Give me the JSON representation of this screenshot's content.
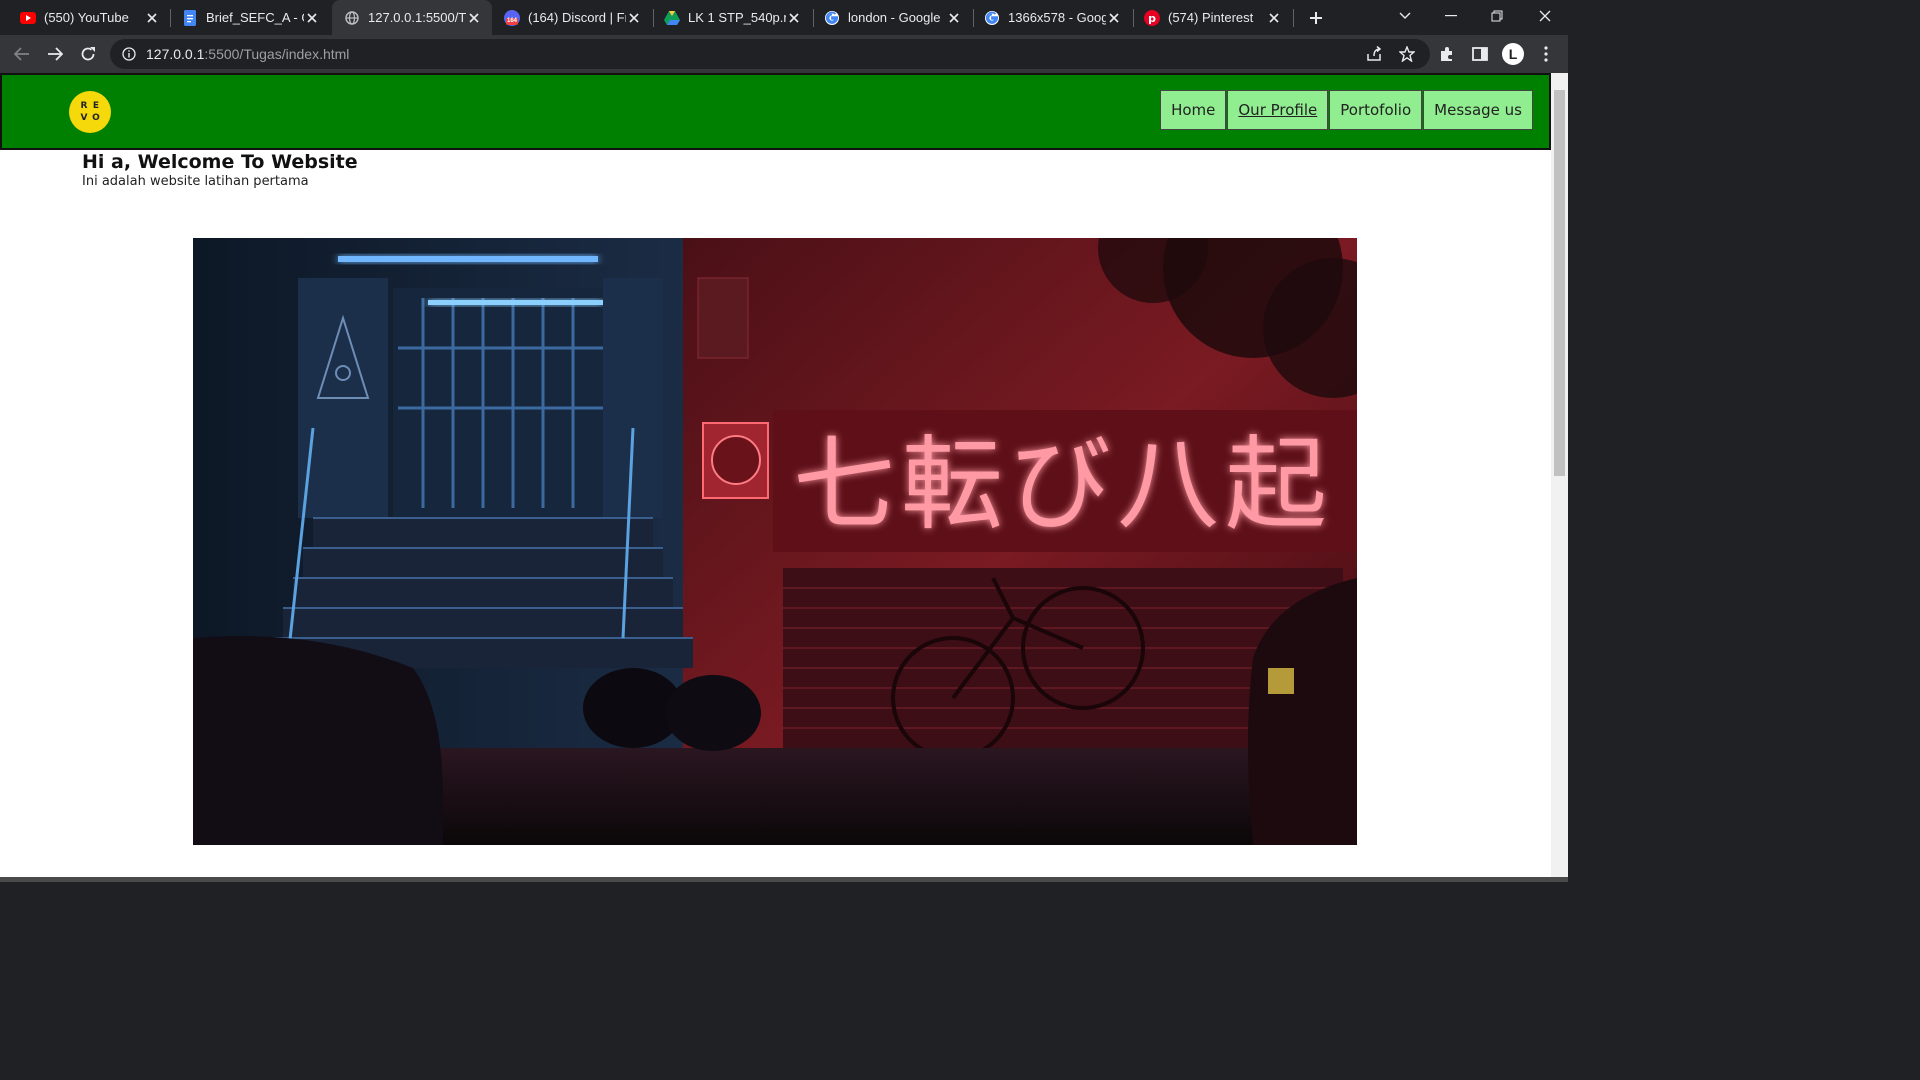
{
  "browser": {
    "tabs": [
      {
        "title": "(550) YouTube",
        "icon": "youtube-icon",
        "active": false
      },
      {
        "title": "Brief_SEFC_A - Go",
        "icon": "google-docs-icon",
        "active": false
      },
      {
        "title": "127.0.0.1:5500/Tu",
        "icon": "globe-icon",
        "active": true
      },
      {
        "title": "(164) Discord | Fri",
        "icon": "discord-icon",
        "badge": "164",
        "active": false
      },
      {
        "title": "LK 1 STP_540p.mp",
        "icon": "google-drive-icon",
        "active": false
      },
      {
        "title": "london - Google",
        "icon": "google-icon",
        "active": false
      },
      {
        "title": "1366x578 - Goog",
        "icon": "google-icon",
        "active": false
      },
      {
        "title": "(574) Pinterest",
        "icon": "pinterest-icon",
        "active": false
      }
    ],
    "url_host": "127.0.0.1",
    "url_rest": ":5500/Tugas/index.html",
    "profile_initial": "L"
  },
  "site": {
    "logo_letters": [
      "R",
      "E",
      "V",
      "O"
    ],
    "nav": [
      "Home",
      "Our Profile",
      "Portofolio",
      "Message us"
    ],
    "hero_title": "Hi a, Welcome To Website",
    "hero_subtitle": "Ini adalah website latihan pertama",
    "sign_text": "七転び八起"
  },
  "colors": {
    "header_bg": "#008000",
    "nav_bg": "#90ee90",
    "logo_bg": "#f5d90a"
  }
}
